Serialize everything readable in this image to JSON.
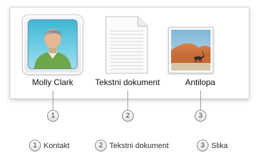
{
  "items": [
    {
      "label": "Molly Clark",
      "number": "1"
    },
    {
      "label": "Tekstni dokument",
      "number": "2"
    },
    {
      "label": "Antilopa",
      "number": "3"
    }
  ],
  "legend": [
    {
      "number": "1",
      "label": "Kontakt"
    },
    {
      "number": "2",
      "label": "Tekstni dokument"
    },
    {
      "number": "3",
      "label": "Slika"
    }
  ]
}
